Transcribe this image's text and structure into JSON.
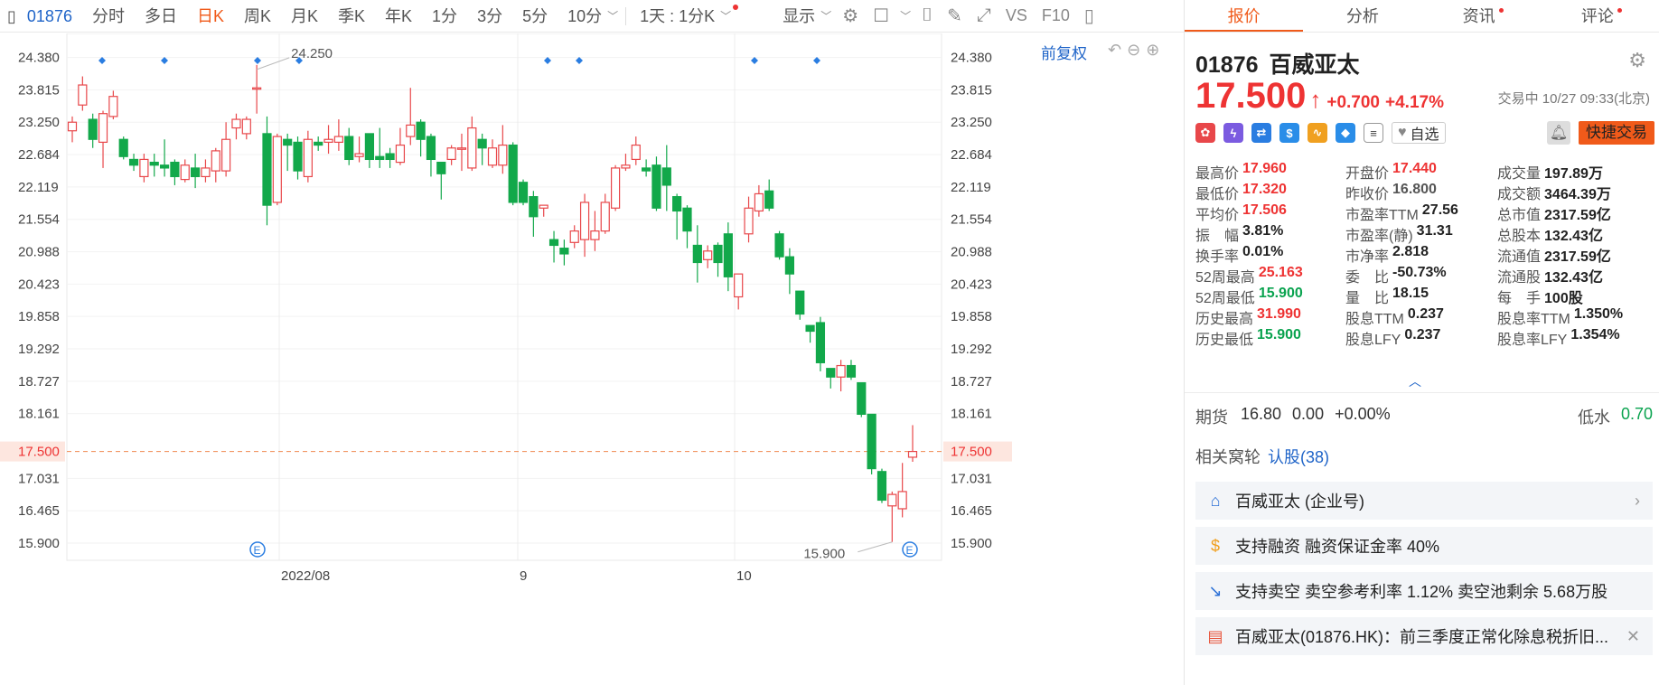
{
  "toolbar": {
    "code": "01876",
    "periods": [
      "分时",
      "多日",
      "日K",
      "周K",
      "月K",
      "季K",
      "年K",
      "1分",
      "3分",
      "5分",
      "10分"
    ],
    "active_period": "日K",
    "interval_label": "1天 : 1分K",
    "display_label": "显示"
  },
  "chart": {
    "adjust_label": "前复权",
    "y_ticks": [
      "24.380",
      "23.815",
      "23.250",
      "22.684",
      "22.119",
      "21.554",
      "20.988",
      "20.423",
      "19.858",
      "19.292",
      "18.727",
      "18.161",
      "17.500",
      "17.031",
      "16.465",
      "15.900"
    ],
    "x_labels": [
      "2022/08",
      "9",
      "10"
    ],
    "high_label": "24.250",
    "low_label": "15.900",
    "current_price": "17.500",
    "event_marker": "E"
  },
  "chart_data": {
    "type": "candlestick",
    "ylim": [
      15.6,
      24.8
    ],
    "candles": [
      [
        23.1,
        23.25,
        22.9,
        23.35
      ],
      [
        23.55,
        23.9,
        23.45,
        24.05
      ],
      [
        23.3,
        22.95,
        22.8,
        23.4
      ],
      [
        22.9,
        23.4,
        22.45,
        23.45
      ],
      [
        23.35,
        23.7,
        23.3,
        23.8
      ],
      [
        22.95,
        22.65,
        22.6,
        23.0
      ],
      [
        22.6,
        22.5,
        22.4,
        22.7
      ],
      [
        22.3,
        22.6,
        22.2,
        22.7
      ],
      [
        22.55,
        22.5,
        22.3,
        22.7
      ],
      [
        22.5,
        22.45,
        22.3,
        22.95
      ],
      [
        22.55,
        22.3,
        22.15,
        22.6
      ],
      [
        22.25,
        22.5,
        22.2,
        22.6
      ],
      [
        22.45,
        22.3,
        22.1,
        22.7
      ],
      [
        22.3,
        22.45,
        22.2,
        22.6
      ],
      [
        22.4,
        22.75,
        22.2,
        22.8
      ],
      [
        22.4,
        22.95,
        22.3,
        23.25
      ],
      [
        23.15,
        23.3,
        22.95,
        23.4
      ],
      [
        23.05,
        23.3,
        22.95,
        23.35
      ],
      [
        23.85,
        23.85,
        23.4,
        24.25
      ],
      [
        23.05,
        21.8,
        21.45,
        23.35
      ],
      [
        21.85,
        23.0,
        21.8,
        23.05
      ],
      [
        22.95,
        22.85,
        22.4,
        23.05
      ],
      [
        22.9,
        22.4,
        22.25,
        23.0
      ],
      [
        22.3,
        22.95,
        22.2,
        23.1
      ],
      [
        22.9,
        22.85,
        22.75,
        23.0
      ],
      [
        22.9,
        22.95,
        22.7,
        23.2
      ],
      [
        22.9,
        23.0,
        22.75,
        23.3
      ],
      [
        23.0,
        22.6,
        22.5,
        23.15
      ],
      [
        22.65,
        22.7,
        22.55,
        23.0
      ],
      [
        23.05,
        22.6,
        22.45,
        23.05
      ],
      [
        22.65,
        22.6,
        22.45,
        23.15
      ],
      [
        22.7,
        22.6,
        22.45,
        22.8
      ],
      [
        22.55,
        22.85,
        22.5,
        23.15
      ],
      [
        23.0,
        23.2,
        22.85,
        23.85
      ],
      [
        23.25,
        22.95,
        22.65,
        23.3
      ],
      [
        23.0,
        22.6,
        22.3,
        23.05
      ],
      [
        22.55,
        22.35,
        21.9,
        22.55
      ],
      [
        22.6,
        22.8,
        22.5,
        22.85
      ],
      [
        22.8,
        22.8,
        22.4,
        23.05
      ],
      [
        22.45,
        23.15,
        22.4,
        23.35
      ],
      [
        22.95,
        22.8,
        22.5,
        23.05
      ],
      [
        22.5,
        22.8,
        22.45,
        22.95
      ],
      [
        22.5,
        22.85,
        22.35,
        23.2
      ],
      [
        22.85,
        21.85,
        21.8,
        22.9
      ],
      [
        22.2,
        21.85,
        21.8,
        22.25
      ],
      [
        21.95,
        21.6,
        21.25,
        22.05
      ],
      [
        21.75,
        21.8,
        21.6,
        21.8
      ],
      [
        21.2,
        21.1,
        20.8,
        21.35
      ],
      [
        21.05,
        20.95,
        20.75,
        21.2
      ],
      [
        21.15,
        21.35,
        21.05,
        21.45
      ],
      [
        21.2,
        21.85,
        20.9,
        22.0
      ],
      [
        21.2,
        21.35,
        21.0,
        21.7
      ],
      [
        21.35,
        21.85,
        21.3,
        22.0
      ],
      [
        21.75,
        22.45,
        21.7,
        22.5
      ],
      [
        22.45,
        22.5,
        22.4,
        22.7
      ],
      [
        22.6,
        22.85,
        22.5,
        23.0
      ],
      [
        22.45,
        22.4,
        22.3,
        22.6
      ],
      [
        22.5,
        21.75,
        21.7,
        22.65
      ],
      [
        22.45,
        22.15,
        21.7,
        22.85
      ],
      [
        21.95,
        21.7,
        21.2,
        22.0
      ],
      [
        21.75,
        21.35,
        21.05,
        21.8
      ],
      [
        21.1,
        20.8,
        20.45,
        21.45
      ],
      [
        20.85,
        21.0,
        20.7,
        21.1
      ],
      [
        21.1,
        20.8,
        20.55,
        21.15
      ],
      [
        21.3,
        20.55,
        20.3,
        21.5
      ],
      [
        20.2,
        20.6,
        19.98,
        20.6
      ],
      [
        21.3,
        21.75,
        21.15,
        21.95
      ],
      [
        21.7,
        22.0,
        21.6,
        22.15
      ],
      [
        22.05,
        21.75,
        21.7,
        22.25
      ],
      [
        21.3,
        20.9,
        20.85,
        21.35
      ],
      [
        20.9,
        20.6,
        20.25,
        21.05
      ],
      [
        20.3,
        19.9,
        19.8,
        20.3
      ],
      [
        19.7,
        19.6,
        19.4,
        19.7
      ],
      [
        19.75,
        19.05,
        18.9,
        19.85
      ],
      [
        18.95,
        18.8,
        18.6,
        18.95
      ],
      [
        18.8,
        19.0,
        18.55,
        19.1
      ],
      [
        19.0,
        18.8,
        18.75,
        19.1
      ],
      [
        18.7,
        18.15,
        18.1,
        18.7
      ],
      [
        18.15,
        17.2,
        17.1,
        18.15
      ],
      [
        17.15,
        16.65,
        16.6,
        17.2
      ],
      [
        16.55,
        16.75,
        15.92,
        16.8
      ],
      [
        16.5,
        16.8,
        16.35,
        17.3
      ],
      [
        17.4,
        17.5,
        17.32,
        17.96
      ]
    ]
  },
  "panel": {
    "tabs": [
      {
        "label": "报价",
        "dot": false
      },
      {
        "label": "分析",
        "dot": false
      },
      {
        "label": "资讯",
        "dot": true
      },
      {
        "label": "评论",
        "dot": true
      }
    ],
    "code": "01876",
    "name": "百威亚太",
    "price": "17.500",
    "change": "+0.700",
    "change_pct": "+4.17%",
    "status": "交易中 10/27 09:33(北京)",
    "watch_label": "自选",
    "quick_trade": "快捷交易",
    "stats": [
      [
        {
          "l": "最高价",
          "v": "17.960",
          "c": "red"
        },
        {
          "l": "开盘价",
          "v": "17.440",
          "c": "red"
        },
        {
          "l": "成交量",
          "v": "197.89万",
          "c": ""
        }
      ],
      [
        {
          "l": "最低价",
          "v": "17.320",
          "c": "red"
        },
        {
          "l": "昨收价",
          "v": "16.800",
          "c": "gray"
        },
        {
          "l": "成交额",
          "v": "3464.39万",
          "c": ""
        }
      ],
      [
        {
          "l": "平均价",
          "v": "17.506",
          "c": "red"
        },
        {
          "l": "市盈率TTM",
          "v": "27.56",
          "c": ""
        },
        {
          "l": "总市值",
          "v": "2317.59亿",
          "c": ""
        }
      ],
      [
        {
          "l": "振　幅",
          "v": "3.81%",
          "c": ""
        },
        {
          "l": "市盈率(静)",
          "v": "31.31",
          "c": ""
        },
        {
          "l": "总股本",
          "v": "132.43亿",
          "c": ""
        }
      ],
      [
        {
          "l": "换手率",
          "v": "0.01%",
          "c": ""
        },
        {
          "l": "市净率",
          "v": "2.818",
          "c": ""
        },
        {
          "l": "流通值",
          "v": "2317.59亿",
          "c": ""
        }
      ],
      [
        {
          "l": "52周最高",
          "v": "25.163",
          "c": "red"
        },
        {
          "l": "委　比",
          "v": "-50.73%",
          "c": ""
        },
        {
          "l": "流通股",
          "v": "132.43亿",
          "c": ""
        }
      ],
      [
        {
          "l": "52周最低",
          "v": "15.900",
          "c": "green"
        },
        {
          "l": "量　比",
          "v": "18.15",
          "c": ""
        },
        {
          "l": "每　手",
          "v": "100股",
          "c": ""
        }
      ],
      [
        {
          "l": "历史最高",
          "v": "31.990",
          "c": "red"
        },
        {
          "l": "股息TTM",
          "v": "0.237",
          "c": ""
        },
        {
          "l": "股息率TTM",
          "v": "1.350%",
          "c": ""
        }
      ],
      [
        {
          "l": "历史最低",
          "v": "15.900",
          "c": "green"
        },
        {
          "l": "股息LFY",
          "v": "0.237",
          "c": ""
        },
        {
          "l": "股息率LFY",
          "v": "1.354%",
          "c": ""
        }
      ]
    ],
    "futures": {
      "label": "期货",
      "price": "16.80",
      "chg": "0.00",
      "pct": "+0.00%",
      "water_label": "低水",
      "water_value": "0.70"
    },
    "warrants": {
      "label": "相关窝轮",
      "link": "认股(38)"
    },
    "cards": [
      {
        "text": "百威亚太 (企业号)",
        "icon": "building-icon"
      },
      {
        "text": "支持融资  融资保证金率 40%",
        "icon": "coin-icon"
      },
      {
        "text": "支持卖空  卖空参考利率 1.12%  卖空池剩余 5.68万股",
        "icon": "chart-down-icon"
      },
      {
        "text": "百威亚太(01876.HK)：前三季度正常化除息税折旧...",
        "icon": "news-icon"
      }
    ]
  }
}
